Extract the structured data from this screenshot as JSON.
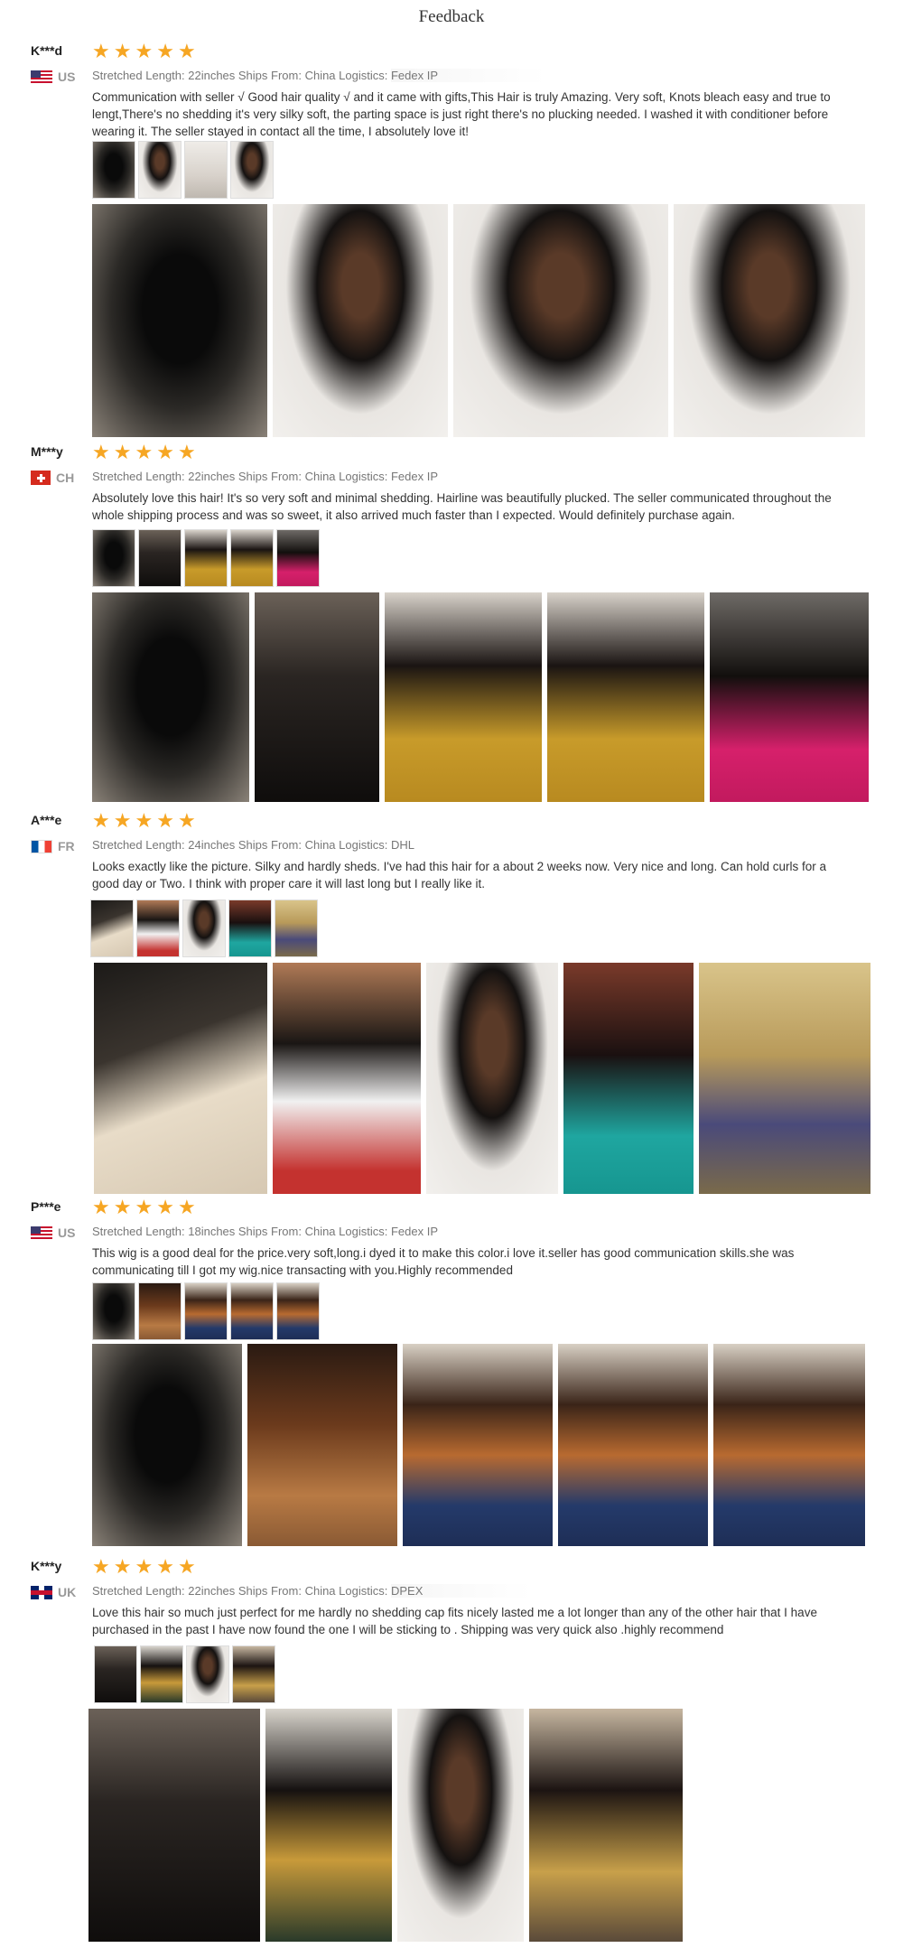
{
  "page": {
    "title": "Feedback"
  },
  "reviews": [
    {
      "user": "K***d",
      "country_code": "US",
      "flag": "flag-us",
      "stars": 5,
      "meta": "Stretched Length: 22inches Ships From: China Logistics: ",
      "logistics": "Fedex IP",
      "text": "Communication with seller √ Good hair quality √ and it came with gifts,This Hair is truly Amazing. Very soft, Knots bleach easy and true to lengt,There's no shedding it's very silky soft, the parting space is just right there's no plucking needed. I washed it with conditioner before wearing it. The seller stayed in contact all the time, I absolutely love it!"
    },
    {
      "user": "M***y",
      "country_code": "CH",
      "flag": "flag-ch",
      "stars": 5,
      "meta": "Stretched Length: 22inches Ships From: China Logistics: ",
      "logistics": "Fedex IP",
      "text": "Absolutely love this hair! It's so very soft and minimal shedding. Hairline was beautifully plucked. The seller communicated throughout the whole shipping process and was so sweet, it also arrived much faster than I expected. Would definitely purchase again."
    },
    {
      "user": "A***e",
      "country_code": "FR",
      "flag": "flag-fr",
      "stars": 5,
      "meta": "Stretched Length: 24inches Ships From: China Logistics: ",
      "logistics": "DHL",
      "text": "Looks exactly like the picture. Silky and hardly sheds. I've had this hair for a about 2 weeks now. Very nice and long. Can hold curls for a good day or Two. I think with proper care it will last long but I really like it."
    },
    {
      "user": "P***e",
      "country_code": "US",
      "flag": "flag-us",
      "stars": 5,
      "meta": "Stretched Length: 18inches Ships From: China Logistics: ",
      "logistics": "Fedex IP",
      "text": "This wig is a good deal for the price.very soft,long.i dyed it to make this color.i love it.seller has good communication skills.she was communicating till I got my wig.nice transacting with you.Highly recommended"
    },
    {
      "user": "K***y",
      "country_code": "UK",
      "flag": "flag-uk",
      "stars": 5,
      "meta": "Stretched Length: 22inches Ships From: China Logistics: ",
      "logistics": "DPEX",
      "text": "Love this hair so much just perfect for me hardly no shedding cap fits nicely lasted me a lot longer than any of the other hair that I have purchased in the past I have now found the one I will be sticking to . Shipping was very quick also .highly recommend"
    }
  ],
  "star_glyph": "★",
  "star_color": "#f6a623"
}
